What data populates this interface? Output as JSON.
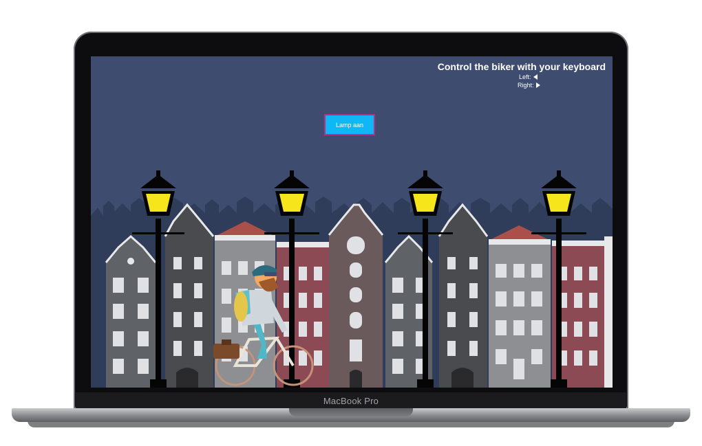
{
  "device": {
    "brand_label": "MacBook Pro"
  },
  "game": {
    "instructions": {
      "title": "Control the biker with your keyboard",
      "left_label": "Left:",
      "right_label": "Right:"
    },
    "lamp_button_label": "Lamp aan",
    "colors": {
      "sky": "#3d4c6f",
      "lamp_glow": "#f7e51c",
      "button": "#0fb8f5",
      "button_border": "#b62f88"
    },
    "icons": [
      "left-arrow-icon",
      "right-arrow-icon"
    ]
  }
}
